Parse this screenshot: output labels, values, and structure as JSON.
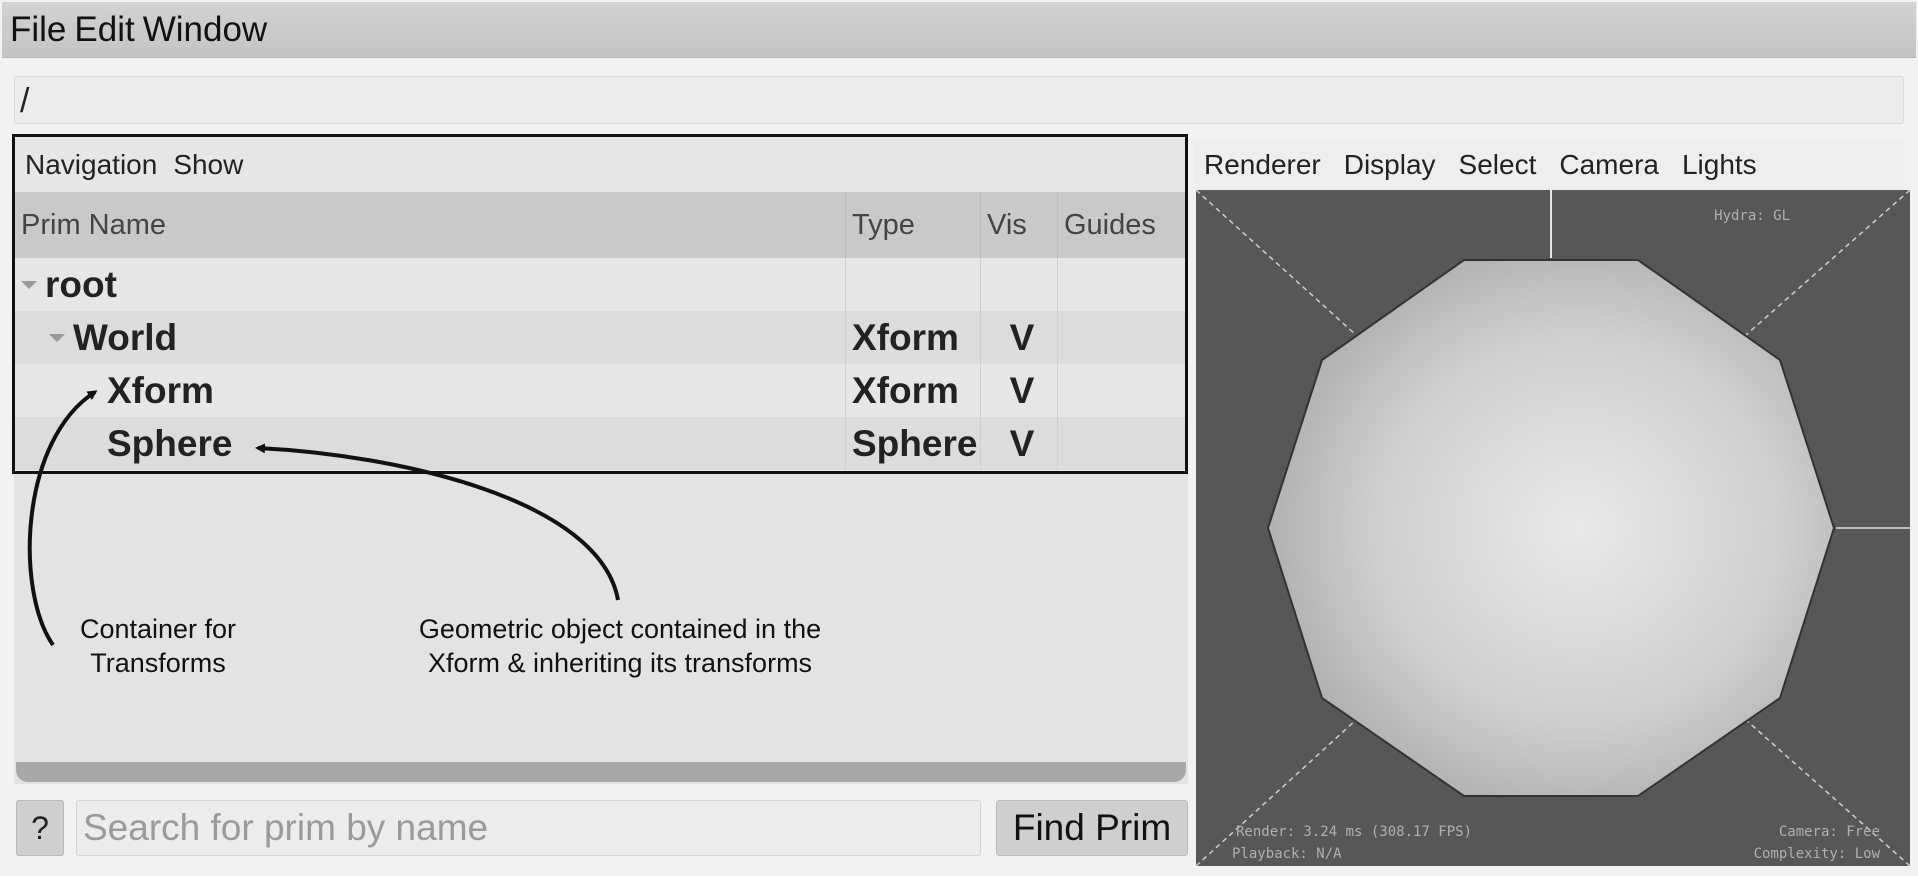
{
  "menubar": {
    "items": [
      "File",
      "Edit",
      "Window"
    ]
  },
  "path": "/",
  "browser": {
    "menu": [
      "Navigation",
      "Show"
    ],
    "columns": [
      "Prim Name",
      "Type",
      "Vis",
      "Guides"
    ],
    "rows": [
      {
        "name": "root",
        "type": "",
        "vis": "",
        "guides": "",
        "expander": true
      },
      {
        "name": "World",
        "type": "Xform",
        "vis": "V",
        "guides": "",
        "expander": true
      },
      {
        "name": "Xform",
        "type": "Xform",
        "vis": "V",
        "guides": "",
        "expander": false
      },
      {
        "name": "Sphere",
        "type": "Sphere",
        "vis": "V",
        "guides": "",
        "expander": false
      }
    ]
  },
  "annotations": {
    "container": "Container for\nTransforms",
    "geometric": "Geometric object contained in the\nXform & inheriting its transforms"
  },
  "search": {
    "help_label": "?",
    "placeholder": "Search for prim by name",
    "find_label": "Find Prim"
  },
  "viewport": {
    "menu": [
      "Renderer",
      "Display",
      "Select",
      "Camera",
      "Lights"
    ],
    "renderer_hud": "Hydra: GL",
    "render_stats": "Render: 3.24 ms (308.17 FPS)",
    "playback": "Playback: N/A",
    "camera": "Camera: Free",
    "complexity": "Complexity: Low"
  }
}
